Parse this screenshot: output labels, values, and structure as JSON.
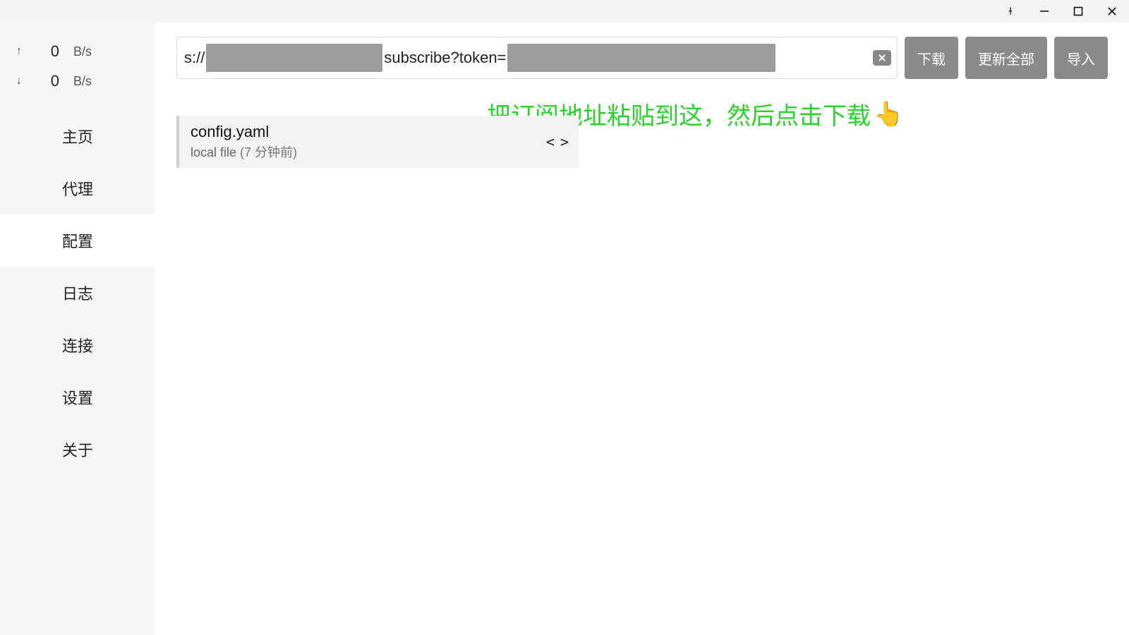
{
  "window": {
    "pin_tooltip": "Pin",
    "minimize_tooltip": "Minimize",
    "maximize_tooltip": "Maximize",
    "close_tooltip": "Close"
  },
  "sidebar": {
    "traffic": {
      "up_arrow": "↑",
      "up_value": "0",
      "up_unit": "B/s",
      "down_arrow": "↓",
      "down_value": "0",
      "down_unit": "B/s"
    },
    "items": [
      {
        "label": "主页"
      },
      {
        "label": "代理"
      },
      {
        "label": "配置"
      },
      {
        "label": "日志"
      },
      {
        "label": "连接"
      },
      {
        "label": "设置"
      },
      {
        "label": "关于"
      }
    ],
    "active_index": 2
  },
  "url_input": {
    "prefix": "s://",
    "mid_text": "subscribe?token=",
    "clear_icon_name": "clear-icon"
  },
  "buttons": {
    "download": "下载",
    "update_all": "更新全部",
    "import": "导入"
  },
  "annotation": {
    "text": "把订阅地址粘贴到这，然后点击下载",
    "emoji": "👆"
  },
  "profile": {
    "name": "config.yaml",
    "source": "local file",
    "time": "(7 分钟前)",
    "code_icon": "< >"
  }
}
